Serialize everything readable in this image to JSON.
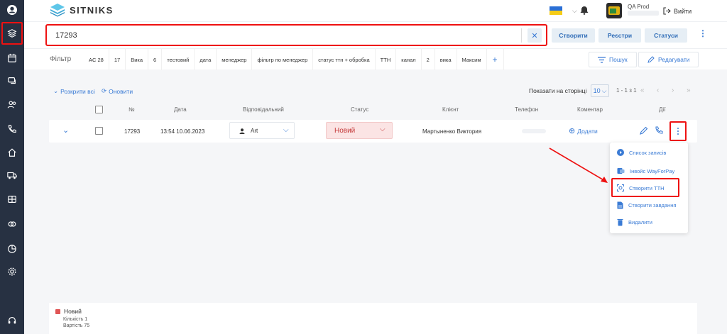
{
  "app": {
    "logo_text": "SITNIKS"
  },
  "header": {
    "user_name": "QA Prod",
    "logout_label": "Вийти",
    "icons": [
      "ukraine-flag-icon",
      "chevron-down-icon",
      "bell-icon",
      "logout-icon"
    ]
  },
  "sidebar": {
    "items": [
      {
        "icon": "user-avatar-icon"
      },
      {
        "icon": "layers-icon",
        "active": true
      },
      {
        "icon": "calendar-icon"
      },
      {
        "icon": "chat-icon"
      },
      {
        "icon": "users-icon"
      },
      {
        "icon": "phone-icon"
      },
      {
        "icon": "home-icon"
      },
      {
        "icon": "truck-icon"
      },
      {
        "icon": "wallet-icon"
      },
      {
        "icon": "chain-icon"
      },
      {
        "icon": "pie-chart-icon"
      },
      {
        "icon": "gear-icon"
      },
      {
        "icon": "headset-icon"
      }
    ]
  },
  "search": {
    "value": "17293",
    "clear_icon": "close-icon",
    "buttons": {
      "create": "Створити",
      "registries": "Реєстри",
      "statuses": "Статуси"
    }
  },
  "filter": {
    "label": "Фільтр",
    "chips": [
      "AC 28",
      "17",
      "Вика",
      "6",
      "тестовий",
      "дата",
      "менеджер",
      "фільтр по менеджер",
      "статус ттн + обробка",
      "ТТН",
      "канал",
      "2",
      "вика",
      "Максим"
    ],
    "add_label": "+",
    "search_label": "Пошук",
    "edit_label": "Редагувати"
  },
  "toolbar": {
    "expand_all": "Розкрити всі",
    "refresh": "Оновити",
    "per_page_label": "Показати на сторінці",
    "per_page_value": "10",
    "range_text": "1 - 1 з 1",
    "pager": [
      "«",
      "‹",
      "›",
      "»"
    ]
  },
  "table": {
    "headers": {
      "number": "№",
      "date": "Дата",
      "responsible": "Відповідальний",
      "status": "Статус",
      "client": "Клієнт",
      "phone": "Телефон",
      "comment": "Коментар",
      "actions": "Дії"
    },
    "rows": [
      {
        "number": "17293",
        "date": "13:54 10.06.2023",
        "responsible": "Art",
        "status": "Новий",
        "client": "Мартыненко Виктория",
        "comment_action": "Додати"
      }
    ]
  },
  "actions_menu": {
    "items": [
      {
        "label": "Список записів",
        "icon": "play-circle-icon"
      },
      {
        "label": "Інвойс WayForPay",
        "icon": "invoice-icon"
      },
      {
        "label": "Створити ТТН",
        "icon": "scan-icon",
        "highlighted": true
      },
      {
        "label": "Створити завдання",
        "icon": "document-icon"
      },
      {
        "label": "Видалити",
        "icon": "trash-icon"
      }
    ]
  },
  "summary": {
    "status": "Новий",
    "count_text": "Кількість 1",
    "value_text": "Вартість 75"
  },
  "colors": {
    "accent": "#3a7bd5",
    "sidebar": "#273142",
    "highlight": "#e11111",
    "status_new": "#e05555"
  }
}
